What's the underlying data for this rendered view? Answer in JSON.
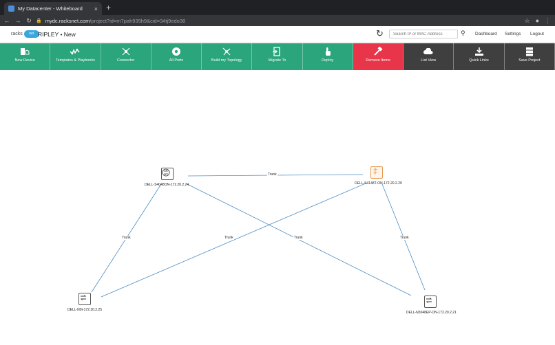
{
  "browser": {
    "tab_title": "My Datacenter - Whiteboard",
    "tab_close": "×",
    "new_tab": "+",
    "url_host": "mydc.racksnet.com",
    "url_path": "/project?id=m7pah935h9&cid=34tj9edo38"
  },
  "header": {
    "logo_text": "racks",
    "logo_badge": "net",
    "project": "RIPLEY • New",
    "search_placeholder": "Search IP or MAC Address",
    "links": {
      "dashboard": "Dashboard",
      "settings": "Settings",
      "logout": "Logout"
    }
  },
  "actions": [
    {
      "label": "New Device",
      "icon": "new-device-icon",
      "style": "green"
    },
    {
      "label": "Templates & Playbooks",
      "icon": "templates-icon",
      "style": "green"
    },
    {
      "label": "Connector",
      "icon": "connector-icon",
      "style": "green"
    },
    {
      "label": "All Ports",
      "icon": "all-ports-icon",
      "style": "green"
    },
    {
      "label": "Build my Topology",
      "icon": "topology-icon",
      "style": "green"
    },
    {
      "label": "Migrate To",
      "icon": "migrate-icon",
      "style": "green"
    },
    {
      "label": "Deploy",
      "icon": "deploy-icon",
      "style": "green"
    },
    {
      "label": "Remove Items",
      "icon": "remove-icon",
      "style": "red"
    },
    {
      "label": "List View",
      "icon": "cloud-icon",
      "style": "dark"
    },
    {
      "label": "Quick Links",
      "icon": "download-icon",
      "style": "dark"
    },
    {
      "label": "Save Project",
      "icon": "server-icon",
      "style": "dark"
    }
  ],
  "colors": {
    "green": "#2ba57c",
    "red": "#e8354a",
    "dark": "#3f3f3f",
    "link": "#4d8bbf"
  },
  "topology": {
    "nodes": [
      {
        "id": "n1",
        "label": "DELL-S4048ON-172.20.2.24",
        "style": "normal"
      },
      {
        "id": "n2",
        "label": "DELL-S4148T-ON-172.20.2.29",
        "style": "orange"
      },
      {
        "id": "n3",
        "label": "DELL-N0t-172.20.2.25",
        "style": "normal"
      },
      {
        "id": "n4",
        "label": "DELL-N3048EP-ON-172.20.2.21",
        "style": "normal"
      }
    ],
    "links": [
      {
        "label": "Trunk"
      },
      {
        "label": "Trunk"
      },
      {
        "label": "Trunk"
      },
      {
        "label": "Trunk"
      },
      {
        "label": "Trunk"
      }
    ]
  }
}
